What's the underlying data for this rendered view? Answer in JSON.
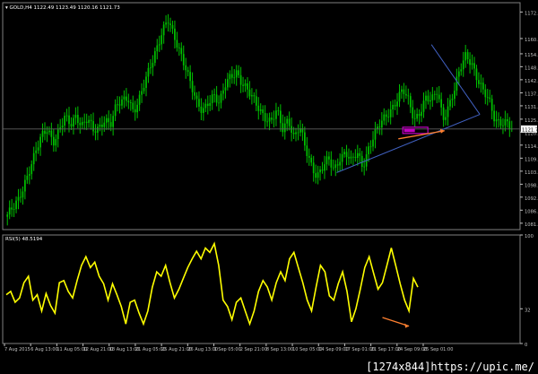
{
  "chart_data": [
    {
      "type": "candlestick",
      "symbol_label": "GOLD,H4",
      "ohlc_readout": "1122.49 1123.49 1120.16 1121.73",
      "y_ticks": [
        1172.0,
        1160.6,
        1154.05,
        1148.5,
        1142.9,
        1137.25,
        1131.7,
        1125.95,
        1120.4,
        1114.8,
        1109.2,
        1103.6,
        1098.0,
        1092.45,
        1086.85,
        1081.25
      ],
      "ylim": [
        1078.5,
        1176.0
      ],
      "current_price_label": "1121.73",
      "current_price": 1121.73,
      "x_ticks": [
        "7 Aug 2015",
        "6 Aug 13:00",
        "11 Aug 05:00",
        "12 Aug 21:00",
        "18 Aug 13:00",
        "21 Aug 05:00",
        "25 Aug 21:00",
        "26 Aug 13:00",
        "1 Sep 05:00",
        "2 Sep 21:00",
        "8 Sep 13:00",
        "10 Sep 05:00",
        "14 Sep 09:00",
        "17 Sep 01:00",
        "21 Sep 17:00",
        "24 Sep 09:00",
        "25 Sep 01:00"
      ],
      "close_path": [
        1085,
        1087,
        1091,
        1099,
        1106,
        1112,
        1118,
        1122,
        1117,
        1121,
        1126,
        1123,
        1128,
        1124,
        1126,
        1120,
        1122,
        1127,
        1124,
        1131,
        1133,
        1136,
        1130,
        1134,
        1141,
        1149,
        1157,
        1164,
        1168,
        1161,
        1156,
        1150,
        1141,
        1132,
        1129,
        1134,
        1137,
        1132,
        1140,
        1145,
        1147,
        1141,
        1137,
        1134,
        1131,
        1127,
        1124,
        1129,
        1122,
        1127,
        1118,
        1122,
        1113,
        1107,
        1102,
        1105,
        1108,
        1104,
        1110,
        1112,
        1107,
        1111,
        1106,
        1114,
        1119,
        1123,
        1127,
        1131,
        1135,
        1138,
        1133,
        1126,
        1130,
        1135,
        1133,
        1138,
        1127,
        1132,
        1138,
        1147,
        1154,
        1151,
        1143,
        1137,
        1134,
        1127,
        1125,
        1124,
        1121
      ],
      "colors": {
        "background": "#000000",
        "candle": "#00c000",
        "grid": "#404040",
        "axis_text": "#c0c0c0",
        "price_line": "#606060",
        "trendline": "#4060c0",
        "annotation_box": "#c000c0",
        "annotation_arrow": "#ff8030"
      },
      "grid": false
    },
    {
      "type": "line",
      "indicator_label": "RSI(5) 48.5194",
      "y_ticks": [
        100,
        32,
        0
      ],
      "ylim": [
        0,
        100
      ],
      "values": [
        45,
        48,
        38,
        42,
        56,
        62,
        40,
        45,
        30,
        46,
        35,
        28,
        56,
        58,
        48,
        42,
        58,
        72,
        80,
        70,
        75,
        62,
        55,
        40,
        55,
        45,
        34,
        18,
        38,
        40,
        28,
        18,
        30,
        52,
        66,
        62,
        72,
        56,
        42,
        50,
        60,
        70,
        78,
        85,
        78,
        88,
        84,
        92,
        72,
        40,
        34,
        22,
        38,
        42,
        30,
        18,
        30,
        48,
        58,
        52,
        40,
        56,
        66,
        58,
        78,
        84,
        70,
        56,
        40,
        30,
        52,
        72,
        66,
        44,
        40,
        55,
        66,
        48,
        20,
        32,
        50,
        70,
        80,
        65,
        50,
        56,
        72,
        88,
        72,
        55,
        40,
        30,
        60,
        52
      ],
      "line_color": "#ffff00",
      "divergence_arrow_color": "#ff8030",
      "grid": false
    }
  ],
  "watermark": "[1274x844]https://upic.me/"
}
